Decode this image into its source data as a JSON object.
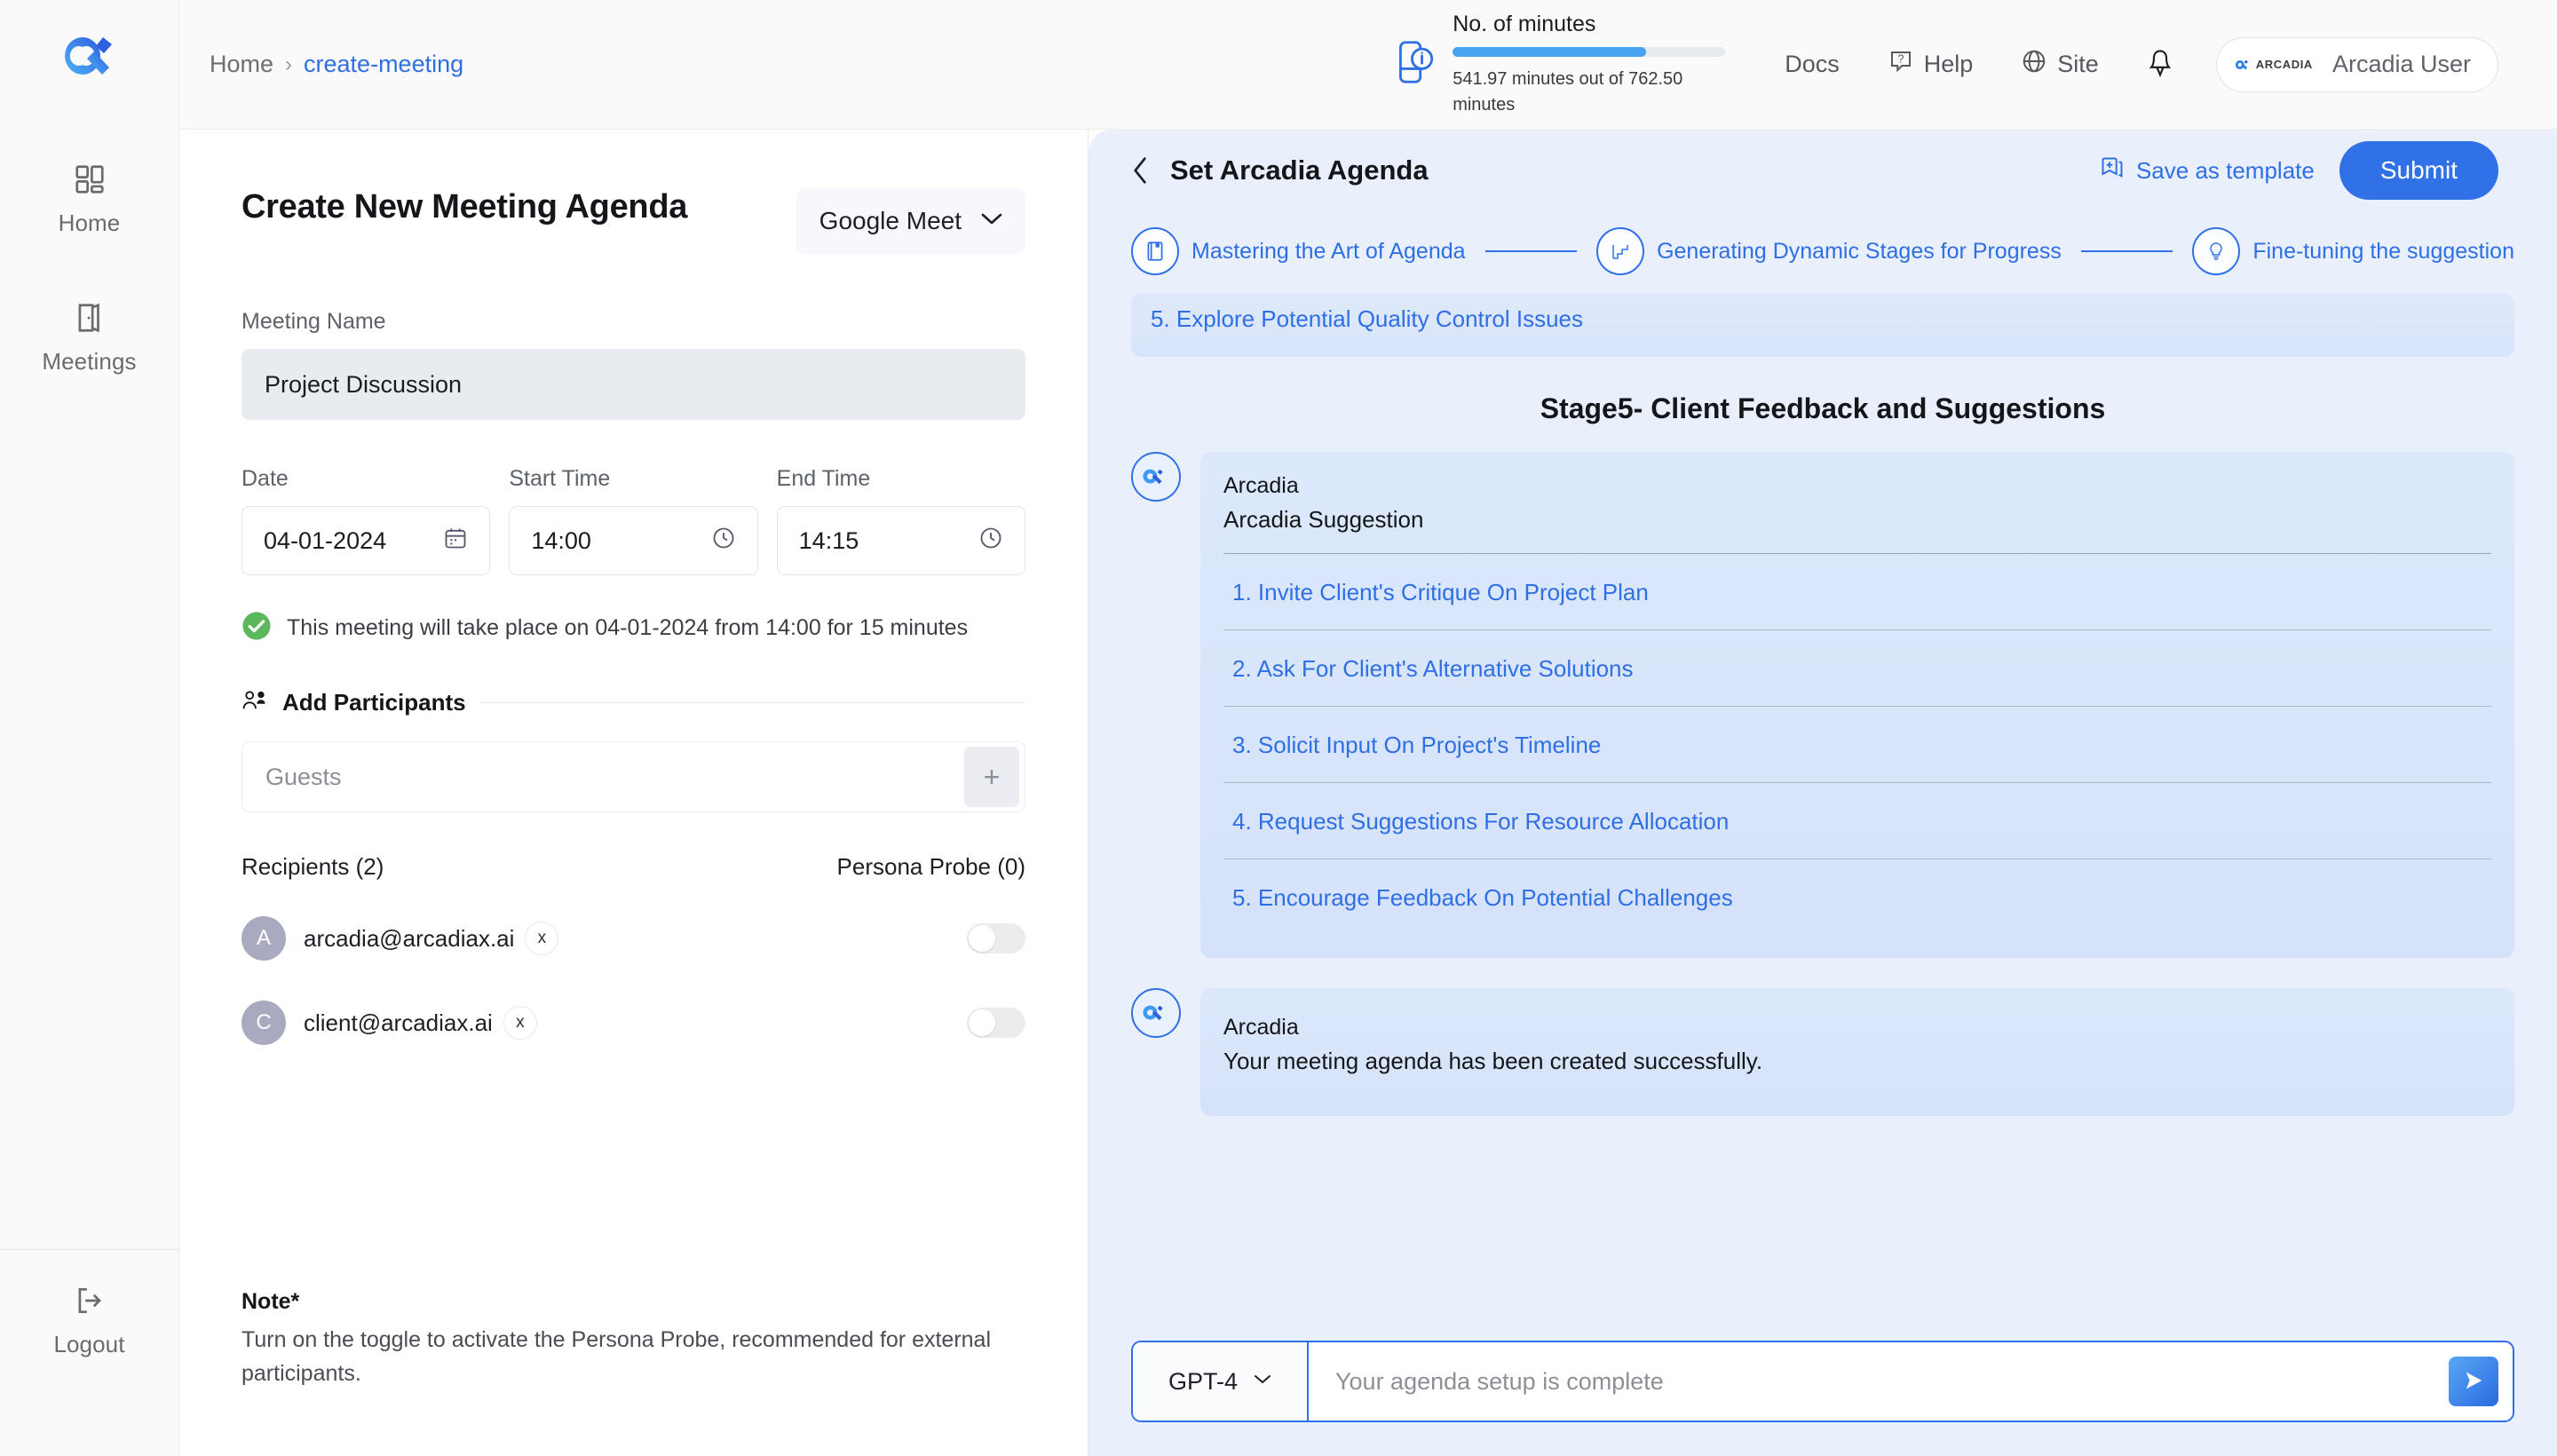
{
  "sidebar": {
    "logo_icon": "arcadia-logo-icon",
    "items": [
      {
        "label": "Home",
        "icon": "grid-icon"
      },
      {
        "label": "Meetings",
        "icon": "door-icon"
      }
    ],
    "logout": {
      "label": "Logout",
      "icon": "logout-icon"
    }
  },
  "topbar": {
    "breadcrumb": {
      "home": "Home",
      "separator": "›",
      "current": "create-meeting"
    },
    "minutes": {
      "title": "No. of minutes",
      "detail": "541.97 minutes out of 762.50 minutes",
      "used": 541.97,
      "total": 762.5,
      "percent": 71,
      "icon": "minutes-info-icon",
      "bar_fill_color": "#4aa3f0",
      "bar_track_color": "#e7ebf0"
    },
    "nav": [
      {
        "label": "Docs",
        "icon": ""
      },
      {
        "label": "Help",
        "icon": "help-circle-icon"
      },
      {
        "label": "Site",
        "icon": "globe-icon"
      }
    ],
    "bell_icon": "notification-bell-icon",
    "user": {
      "brand": "ARCADIA",
      "name": "Arcadia User",
      "logo_icon": "arcadia-mark-icon"
    }
  },
  "form": {
    "title": "Create New Meeting Agenda",
    "platform_select": {
      "value": "Google Meet",
      "chevron": "chevron-down-icon"
    },
    "meeting_name": {
      "label": "Meeting Name",
      "value": "Project Discussion"
    },
    "date": {
      "label": "Date",
      "value": "04-01-2024",
      "icon": "calendar-icon"
    },
    "start_time": {
      "label": "Start Time",
      "value": "14:00",
      "icon": "clock-icon"
    },
    "end_time": {
      "label": "End Time",
      "value": "14:15",
      "icon": "clock-icon"
    },
    "confirmation": {
      "icon": "check-circle-icon",
      "color": "#5cb85c",
      "text": "This meeting will take place on 04-01-2024 from 14:00 for 15 minutes"
    },
    "participants": {
      "label": "Add Participants",
      "icon": "add-person-icon"
    },
    "guests": {
      "placeholder": "Guests",
      "add_label": "+"
    },
    "recipients_label": "Recipients (2)",
    "persona_probe_label": "Persona Probe (0)",
    "recipients": [
      {
        "initial": "A",
        "email": "arcadia@arcadiax.ai",
        "remove": "x",
        "toggle_on": false
      },
      {
        "initial": "C",
        "email": "client@arcadiax.ai",
        "remove": "x",
        "toggle_on": false
      }
    ],
    "note": {
      "title": "Note*",
      "text": "Turn on the toggle to activate the Persona Probe, recommended for external participants."
    }
  },
  "agenda": {
    "back_icon": "chevron-left-icon",
    "title": "Set Arcadia Agenda",
    "save_template": {
      "label": "Save as template",
      "icon": "save-template-icon"
    },
    "submit_label": "Submit",
    "steps": [
      {
        "label": "Mastering the Art of Agenda",
        "icon": "book-icon"
      },
      {
        "label": "Generating Dynamic Stages for Progress",
        "icon": "stairs-icon"
      },
      {
        "label": "Fine-tuning the suggestion",
        "icon": "lightbulb-icon"
      }
    ],
    "previous_item": "5. Explore Potential Quality Control Issues",
    "stage_title": "Stage5- Client Feedback and Suggestions",
    "suggestion_block": {
      "sender": "Arcadia",
      "subtitle": "Arcadia Suggestion",
      "avatar_icon": "arcadia-avatar-icon",
      "items": [
        "1. Invite Client's Critique On Project Plan",
        "2. Ask For Client's Alternative Solutions",
        "3. Solicit Input On Project's Timeline",
        "4. Request Suggestions For Resource Allocation",
        "5. Encourage Feedback On Potential Challenges"
      ]
    },
    "final_message": {
      "sender": "Arcadia",
      "text": "Your meeting agenda has been created successfully.",
      "avatar_icon": "arcadia-avatar-icon"
    },
    "chat": {
      "model": "GPT-4",
      "model_chevron": "chevron-down-icon",
      "input_value": "",
      "input_placeholder": "Your agenda setup is complete",
      "send_icon": "send-icon"
    }
  },
  "colors": {
    "accent_blue": "#3071e8",
    "link_blue": "#2f6fe4",
    "panel_bg": "#e9effb",
    "card_bg": "#dce8fb",
    "success_green": "#5cb85c"
  }
}
